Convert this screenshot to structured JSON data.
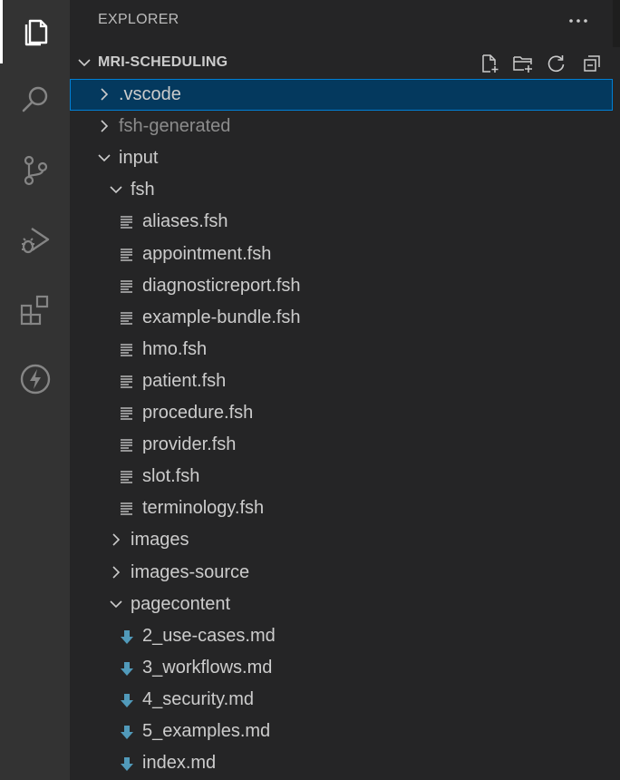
{
  "explorer": {
    "title": "EXPLORER",
    "more_actions_icon": "ellipsis-icon"
  },
  "activity_bar": {
    "items": [
      {
        "name": "explorer",
        "icon": "files-icon",
        "active": true
      },
      {
        "name": "search",
        "icon": "search-icon",
        "active": false
      },
      {
        "name": "source-control",
        "icon": "source-control-icon",
        "active": false
      },
      {
        "name": "run-debug",
        "icon": "run-debug-icon",
        "active": false
      },
      {
        "name": "extensions",
        "icon": "extensions-icon",
        "active": false
      },
      {
        "name": "lightning",
        "icon": "lightning-icon",
        "active": false
      }
    ]
  },
  "workspace": {
    "name": "MRI-SCHEDULING",
    "actions": [
      "new-file-icon",
      "new-folder-icon",
      "refresh-icon",
      "collapse-all-icon"
    ]
  },
  "tree": [
    {
      "label": ".vscode",
      "type": "folder",
      "expanded": false,
      "depth": 0,
      "selected": true
    },
    {
      "label": "fsh-generated",
      "type": "folder",
      "expanded": false,
      "depth": 0,
      "dim": true
    },
    {
      "label": "input",
      "type": "folder",
      "expanded": true,
      "depth": 0
    },
    {
      "label": "fsh",
      "type": "folder",
      "expanded": true,
      "depth": 1
    },
    {
      "label": "aliases.fsh",
      "type": "file-fsh",
      "depth": 2
    },
    {
      "label": "appointment.fsh",
      "type": "file-fsh",
      "depth": 2
    },
    {
      "label": "diagnosticreport.fsh",
      "type": "file-fsh",
      "depth": 2
    },
    {
      "label": "example-bundle.fsh",
      "type": "file-fsh",
      "depth": 2
    },
    {
      "label": "hmo.fsh",
      "type": "file-fsh",
      "depth": 2
    },
    {
      "label": "patient.fsh",
      "type": "file-fsh",
      "depth": 2
    },
    {
      "label": "procedure.fsh",
      "type": "file-fsh",
      "depth": 2
    },
    {
      "label": "provider.fsh",
      "type": "file-fsh",
      "depth": 2
    },
    {
      "label": "slot.fsh",
      "type": "file-fsh",
      "depth": 2
    },
    {
      "label": "terminology.fsh",
      "type": "file-fsh",
      "depth": 2
    },
    {
      "label": "images",
      "type": "folder",
      "expanded": false,
      "depth": 1
    },
    {
      "label": "images-source",
      "type": "folder",
      "expanded": false,
      "depth": 1
    },
    {
      "label": "pagecontent",
      "type": "folder",
      "expanded": true,
      "depth": 1
    },
    {
      "label": "2_use-cases.md",
      "type": "file-md",
      "depth": 2
    },
    {
      "label": "3_workflows.md",
      "type": "file-md",
      "depth": 2
    },
    {
      "label": "4_security.md",
      "type": "file-md",
      "depth": 2
    },
    {
      "label": "5_examples.md",
      "type": "file-md",
      "depth": 2
    },
    {
      "label": "index.md",
      "type": "file-md",
      "depth": 2
    }
  ],
  "colors": {
    "activity_bar_bg": "#333333",
    "sidebar_bg": "#252526",
    "selection_bg": "#04395e",
    "selection_border": "#007fd4",
    "markdown_icon": "#519aba",
    "text": "#cccccc",
    "dim_text": "#8c8c8c"
  }
}
